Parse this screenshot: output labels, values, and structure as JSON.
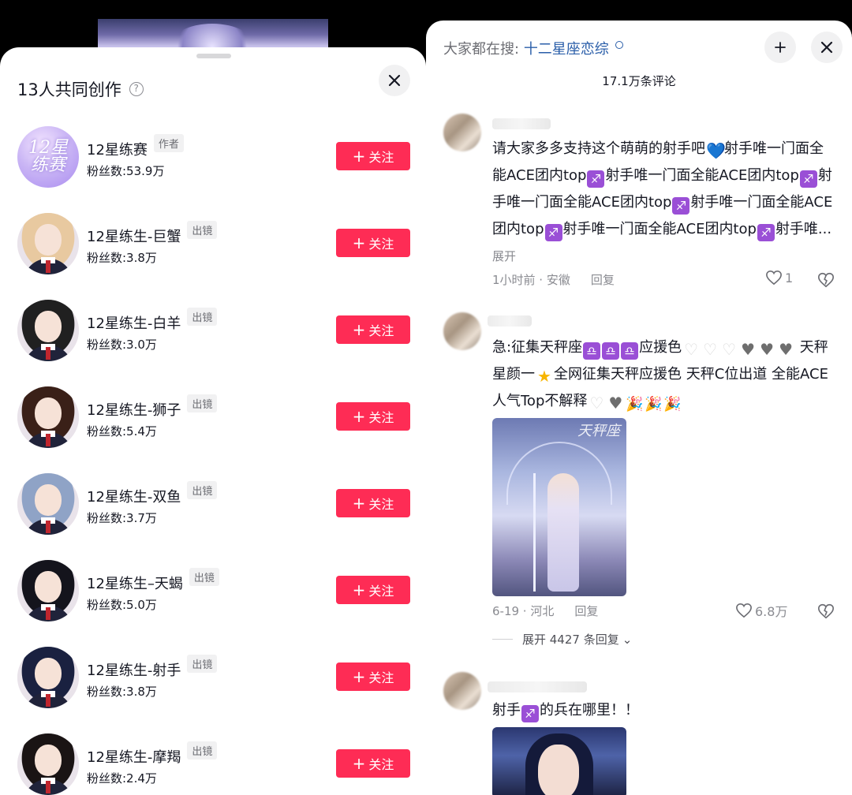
{
  "left_sheet": {
    "title": "13人共同创作",
    "help_icon_glyph": "?",
    "creators": [
      {
        "name": "12星练赛",
        "tag": "作者",
        "fans": "粉丝数:53.9万",
        "follow": "关注",
        "avatar": "brand-logo",
        "brand_text": "12星\n练赛"
      },
      {
        "name": "12星练生-巨蟹",
        "tag": "出镜",
        "fans": "粉丝数:3.8万",
        "follow": "关注",
        "avatar": "girl-blonde",
        "hair": "#e8c9a0"
      },
      {
        "name": "12星练生-白羊",
        "tag": "出镜",
        "fans": "粉丝数:3.0万",
        "follow": "关注",
        "avatar": "girl-black-horns",
        "hair": "#202020"
      },
      {
        "name": "12星练生-狮子",
        "tag": "出镜",
        "fans": "粉丝数:5.4万",
        "follow": "关注",
        "avatar": "girl-dark-brown",
        "hair": "#3a2018"
      },
      {
        "name": "12星练生-双鱼",
        "tag": "出镜",
        "fans": "粉丝数:3.7万",
        "follow": "关注",
        "avatar": "girl-blue-gray",
        "hair": "#8fa3c6"
      },
      {
        "name": "12星练生–天蝎",
        "tag": "出镜",
        "fans": "粉丝数:5.0万",
        "follow": "关注",
        "avatar": "girl-black",
        "hair": "#14141c"
      },
      {
        "name": "12星练生-射手",
        "tag": "出镜",
        "fans": "粉丝数:3.8万",
        "follow": "关注",
        "avatar": "girl-navy",
        "hair": "#1a2140"
      },
      {
        "name": "12星练生-摩羯",
        "tag": "出镜",
        "fans": "粉丝数:2.4万",
        "follow": "关注",
        "avatar": "girl-black-horns",
        "hair": "#1a1414"
      }
    ]
  },
  "right_sheet": {
    "search_label": "大家都在搜:",
    "search_keyword": "十二星座恋综",
    "comment_count": "17.1万条评论",
    "comments": [
      {
        "text_parts": [
          "请大家多多支持这个萌萌的射手吧",
          "💙",
          "射手唯一门面全能ACE团内top",
          "♐",
          "射手唯一门面全能ACE团内top",
          "♐",
          "射手唯一门面全能ACE团内top",
          "♐",
          "射手唯一门面全能ACE团内top",
          "♐",
          "射手唯一门面全能ACE团内top",
          "♐",
          "射手唯..."
        ],
        "expand": "展开",
        "meta": "1小时前 · 安徽",
        "reply": "回复",
        "likes": "1"
      },
      {
        "text_parts": [
          "急:征集天秤座",
          "♎",
          "♎",
          "♎",
          "应援色",
          "♡",
          "♡",
          "♡",
          "♥",
          "♥",
          "♥",
          " 天秤星颜一",
          "★",
          "全网征集天秤应援色 天秤C位出道 全能ACE人气Top不解释",
          "♡",
          "♥",
          "🎉",
          "🎉",
          "🎉"
        ],
        "image_caption": "天秤座",
        "meta": "6-19 · 河北",
        "reply": "回复",
        "likes": "6.8万",
        "replies": "展开 4427 条回复"
      },
      {
        "text_parts": [
          "射手",
          "♐",
          "的兵在哪里！！"
        ]
      }
    ]
  },
  "icons": {
    "close": "close-icon",
    "collapse": "collapse-icon",
    "like": "heart-outline-icon",
    "dislike": "broken-heart-icon"
  },
  "colors": {
    "follow_button": "#fe2c55",
    "search_keyword": "#2a5ea9",
    "secondary_text": "#8a8b91"
  }
}
